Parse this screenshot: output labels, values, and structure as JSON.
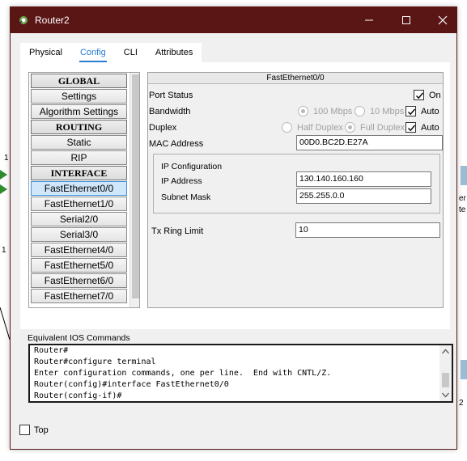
{
  "window": {
    "title": "Router2",
    "title_bar_color": "#5a1515"
  },
  "tabs": [
    {
      "label": "Physical",
      "active": false
    },
    {
      "label": "Config",
      "active": true
    },
    {
      "label": "CLI",
      "active": false
    },
    {
      "label": "Attributes",
      "active": false
    }
  ],
  "nav": {
    "items": [
      {
        "label": "GLOBAL",
        "type": "header"
      },
      {
        "label": "Settings",
        "type": "item"
      },
      {
        "label": "Algorithm Settings",
        "type": "item"
      },
      {
        "label": "ROUTING",
        "type": "header"
      },
      {
        "label": "Static",
        "type": "item"
      },
      {
        "label": "RIP",
        "type": "item"
      },
      {
        "label": "INTERFACE",
        "type": "header"
      },
      {
        "label": "FastEthernet0/0",
        "type": "item",
        "selected": true
      },
      {
        "label": "FastEthernet1/0",
        "type": "item"
      },
      {
        "label": "Serial2/0",
        "type": "item"
      },
      {
        "label": "Serial3/0",
        "type": "item"
      },
      {
        "label": "FastEthernet4/0",
        "type": "item"
      },
      {
        "label": "FastEthernet5/0",
        "type": "item"
      },
      {
        "label": "FastEthernet6/0",
        "type": "item"
      },
      {
        "label": "FastEthernet7/0",
        "type": "item"
      }
    ]
  },
  "interface": {
    "header": "FastEthernet0/0",
    "port_status_label": "Port Status",
    "port_on_label": "On",
    "port_on": true,
    "bandwidth_label": "Bandwidth",
    "bw_100": "100 Mbps",
    "bw_10": "10 Mbps",
    "bw_auto": "Auto",
    "bw_auto_checked": true,
    "duplex_label": "Duplex",
    "half_duplex": "Half Duplex",
    "full_duplex": "Full Duplex",
    "duplex_auto": "Auto",
    "duplex_auto_checked": true,
    "mac_label": "MAC Address",
    "mac_value": "00D0.BC2D.E27A",
    "ip_config_label": "IP Configuration",
    "ip_label": "IP Address",
    "ip_value": "130.140.160.160",
    "mask_label": "Subnet Mask",
    "mask_value": "255.255.0.0",
    "tx_ring_label": "Tx Ring Limit",
    "tx_ring_value": "10"
  },
  "ios": {
    "label": "Equivalent IOS Commands",
    "lines": [
      "Router#",
      "Router#configure terminal",
      "Enter configuration commands, one per line.  End with CNTL/Z.",
      "Router(config)#interface FastEthernet0/0",
      "Router(config-if)#"
    ]
  },
  "footer": {
    "top_label": "Top",
    "top_checked": false
  },
  "background": {
    "left_labels": [
      "1",
      "1"
    ],
    "right_labels": [
      "er",
      "te",
      "2"
    ]
  }
}
